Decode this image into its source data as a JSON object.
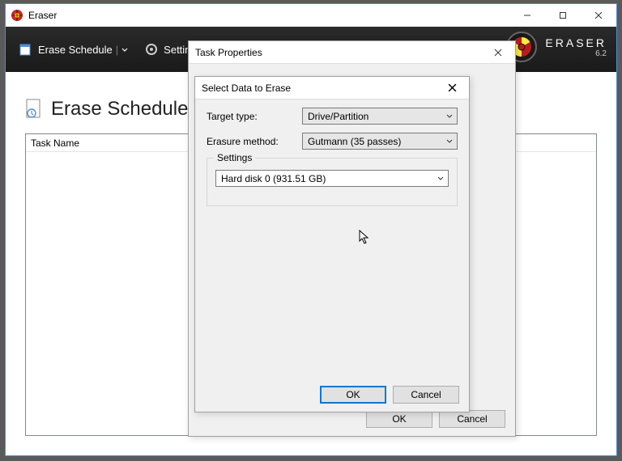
{
  "app": {
    "title": "Eraser"
  },
  "toolbar": {
    "erase_schedule": "Erase Schedule",
    "settings": "Settings"
  },
  "brand": {
    "name": "ERASER",
    "version": "6.2"
  },
  "page": {
    "title": "Erase Schedule",
    "column_task_name": "Task Name"
  },
  "dlg_task": {
    "title": "Task Properties",
    "ok": "OK",
    "cancel": "Cancel"
  },
  "dlg_data": {
    "title": "Select Data to Erase",
    "target_type_label": "Target type:",
    "target_type_value": "Drive/Partition",
    "erasure_method_label": "Erasure method:",
    "erasure_method_value": "Gutmann (35 passes)",
    "settings_legend": "Settings",
    "drive_value": "Hard disk 0 (931.51 GB)",
    "ok": "OK",
    "cancel": "Cancel"
  }
}
